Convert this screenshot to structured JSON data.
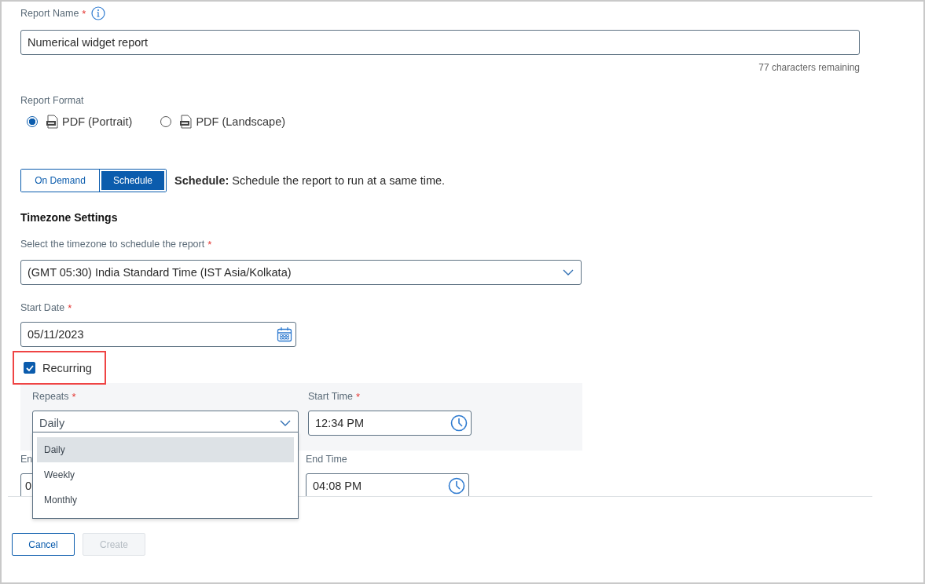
{
  "report_name": {
    "label": "Report Name",
    "required_mark": "*",
    "value": "Numerical widget report",
    "counter": "77 characters remaining"
  },
  "report_format": {
    "label": "Report Format",
    "options": [
      {
        "label": "PDF (Portrait)",
        "selected": true
      },
      {
        "label": "PDF (Landscape)",
        "selected": false
      }
    ]
  },
  "mode_toggle": [
    {
      "label": "On Demand",
      "selected": false
    },
    {
      "label": "Schedule",
      "selected": true
    }
  ],
  "mode_description": "**Schedule:** Schedule the report to run at a same time.",
  "timezone_settings": {
    "heading": "Timezone Settings",
    "label": "Select the timezone to schedule the report",
    "required_mark": "*",
    "value": "(GMT 05:30) India Standard Time (IST Asia/Kolkata)"
  },
  "start_date": {
    "label": "Start Date",
    "required_mark": "*",
    "value": "05/11/2023"
  },
  "recurring": {
    "label": "Recurring",
    "checked": true,
    "highlighted": true
  },
  "repeats": {
    "label": "Repeats",
    "required_mark": "*",
    "value": "Daily",
    "expanded": true,
    "options": [
      {
        "label": "Daily",
        "selected": true
      },
      {
        "label": "Weekly",
        "selected": false
      },
      {
        "label": "Monthly",
        "selected": false
      }
    ]
  },
  "start_time": {
    "label": "Start Time",
    "required_mark": "*",
    "value": "12:34 PM"
  },
  "end_date": {
    "label": "En",
    "value": "0"
  },
  "end_time": {
    "label": "End Time",
    "value": "04:08 PM"
  },
  "buttons": [
    {
      "label": "Cancel",
      "disabled": false
    },
    {
      "label": "Create",
      "disabled": true
    }
  ]
}
